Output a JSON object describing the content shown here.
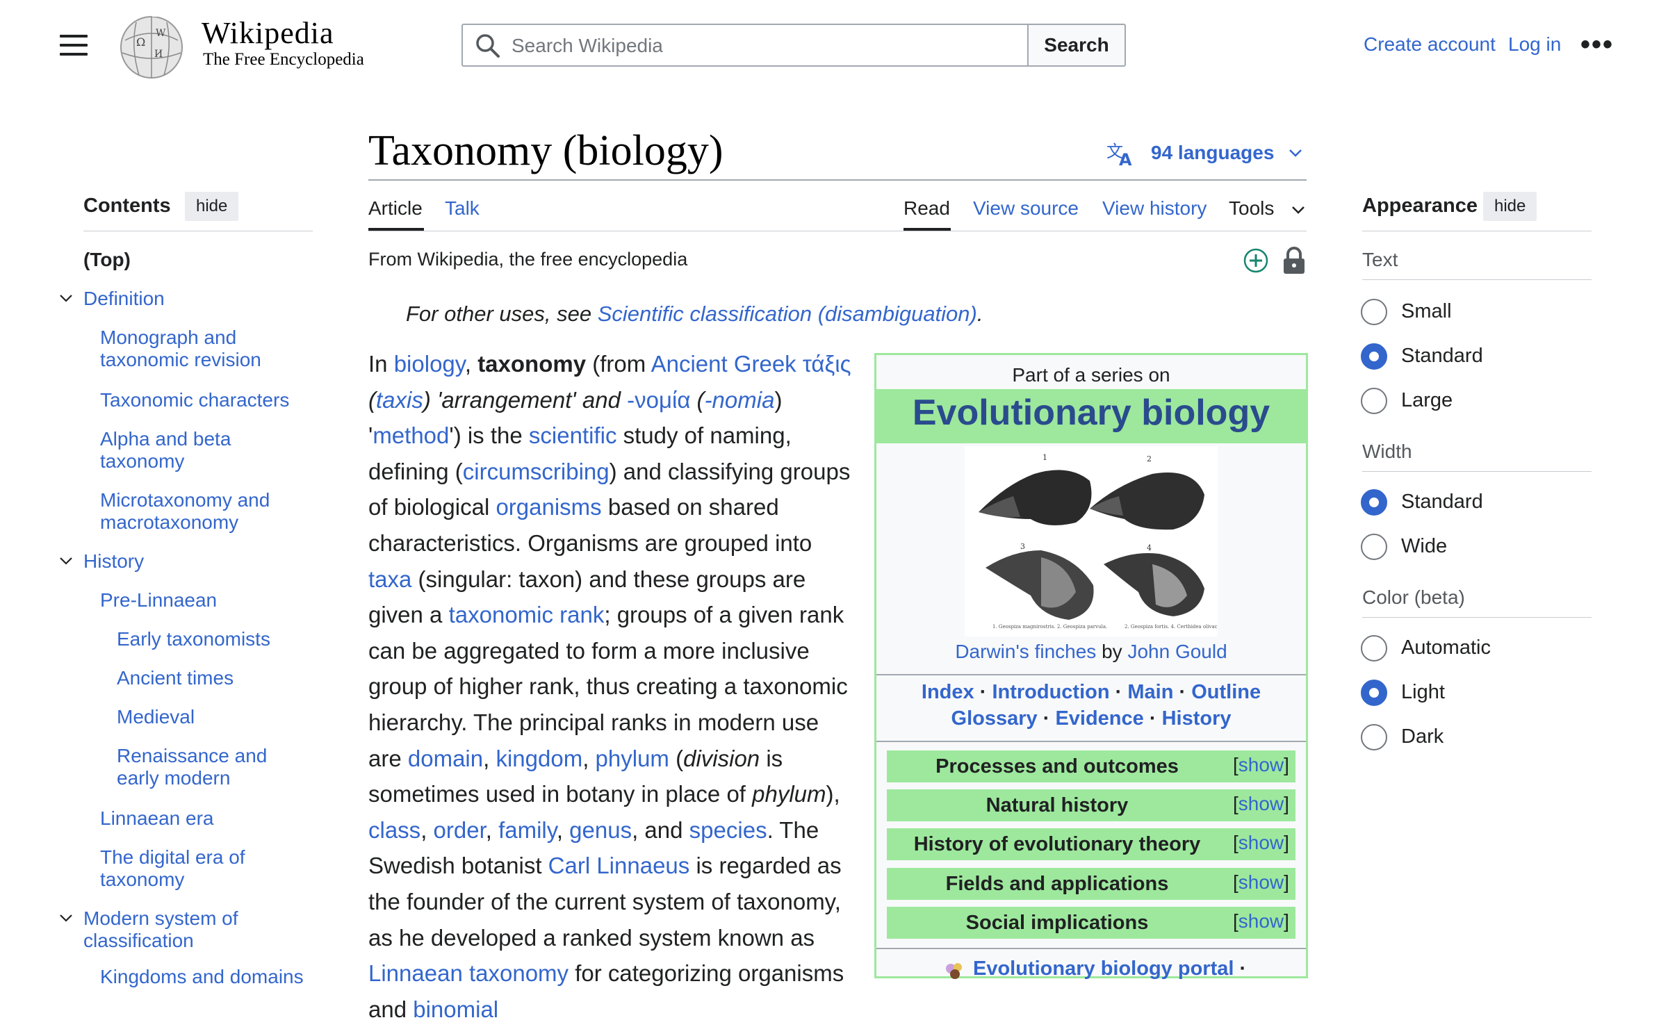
{
  "header": {
    "logo_wordmark": "Wikipedia",
    "logo_tagline": "The Free Encyclopedia",
    "search_placeholder": "Search Wikipedia",
    "search_button": "Search",
    "create_account": "Create account",
    "login": "Log in",
    "more": "•••"
  },
  "page": {
    "title": "Taxonomy (biology)",
    "languages": "94 languages",
    "tabs": {
      "article": "Article",
      "talk": "Talk",
      "read": "Read",
      "view_source": "View source",
      "view_history": "View history",
      "tools": "Tools"
    },
    "from": "From Wikipedia, the free encyclopedia",
    "hatnote_prefix": "For other uses, see ",
    "hatnote_link": "Scientific classification (disambiguation)",
    "hatnote_suffix": "."
  },
  "toc": {
    "title": "Contents",
    "hide": "hide",
    "items": [
      {
        "label": "(Top)"
      },
      {
        "label": "Definition"
      },
      {
        "label": "Monograph and taxonomic revision"
      },
      {
        "label": "Taxonomic characters"
      },
      {
        "label": "Alpha and beta taxonomy"
      },
      {
        "label": "Microtaxonomy and macrotaxonomy"
      },
      {
        "label": "History"
      },
      {
        "label": "Pre-Linnaean"
      },
      {
        "label": "Early taxonomists"
      },
      {
        "label": "Ancient times"
      },
      {
        "label": "Medieval"
      },
      {
        "label": "Renaissance and early modern"
      },
      {
        "label": "Linnaean era"
      },
      {
        "label": "The digital era of taxonomy"
      },
      {
        "label": "Modern system of classification"
      },
      {
        "label": "Kingdoms and domains"
      }
    ]
  },
  "body": {
    "t1": "In ",
    "l1": "biology",
    "t2": ", ",
    "b1": "taxonomy",
    "t3": " (from ",
    "l2": "Ancient Greek",
    "t4": " ",
    "l3": "τάξις",
    "t5": " (",
    "l4": "taxis",
    "t6": ") 'arrangement' and ",
    "l5": "-νομία",
    "t7": " (",
    "l6": "-nomia",
    "t8": ") '",
    "l7": "method",
    "t9": "') is the ",
    "l8": "scientific",
    "t10": " study of naming, defining (",
    "l9": "circumscribing",
    "t11": ") and classifying groups of biological ",
    "l10": "organisms",
    "t12": " based on shared characteristics. Organisms are grouped into ",
    "l11": "taxa",
    "t13": " (singular: taxon) and these groups are given a ",
    "l12": "taxonomic rank",
    "t14": "; groups of a given rank can be aggregated to form a more inclusive group of higher rank, thus creating a taxonomic hierarchy. The principal ranks in modern use are ",
    "l13": "domain",
    "t15": ", ",
    "l14": "kingdom",
    "t16": ", ",
    "l15": "phylum",
    "t17": " (",
    "i1": "division",
    "t18": " is sometimes used in botany in place of ",
    "i2": "phylum",
    "t19": "), ",
    "l16": "class",
    "t20": ", ",
    "l17": "order",
    "t21": ", ",
    "l18": "family",
    "t22": ", ",
    "l19": "genus",
    "t23": ", and ",
    "l20": "species",
    "t24": ". The Swedish botanist ",
    "l21": "Carl Linnaeus",
    "t25": " is regarded as the founder of the current system of taxonomy, as he developed a ranked system known as ",
    "l22": "Linnaean taxonomy",
    "t26": " for categorizing organisms and ",
    "l23": "binomial"
  },
  "infobox": {
    "part_of": "Part of a series on",
    "title": "Evolutionary biology",
    "caption_link1": "Darwin's finches",
    "caption_by": " by ",
    "caption_link2": "John Gould",
    "figure_numbers": [
      "1",
      "2",
      "3",
      "4"
    ],
    "figure_legend_left": "1. Geospiza magnirostris.\n2. Geospiza parvula.",
    "figure_legend_right": "2. Geospiza fortis.\n4. Certhidea olivacea.",
    "nav1": [
      "Index",
      "Introduction",
      "Main",
      "Outline"
    ],
    "nav2": [
      "Glossary",
      "Evidence",
      "History"
    ],
    "sep": " · ",
    "rows": [
      {
        "label": "Processes and outcomes",
        "show": "show"
      },
      {
        "label": "Natural history",
        "show": "show"
      },
      {
        "label": "History of evolutionary theory",
        "show": "show"
      },
      {
        "label": "Fields and applications",
        "show": "show"
      },
      {
        "label": "Social implications",
        "show": "show"
      }
    ],
    "portal": "Evolutionary biology portal",
    "portal_suffix": " ·"
  },
  "appearance": {
    "title": "Appearance",
    "hide": "hide",
    "text_label": "Text",
    "text_options": [
      {
        "label": "Small",
        "selected": false
      },
      {
        "label": "Standard",
        "selected": true
      },
      {
        "label": "Large",
        "selected": false
      }
    ],
    "width_label": "Width",
    "width_options": [
      {
        "label": "Standard",
        "selected": true
      },
      {
        "label": "Wide",
        "selected": false
      }
    ],
    "color_label": "Color (beta)",
    "color_options": [
      {
        "label": "Automatic",
        "selected": false
      },
      {
        "label": "Light",
        "selected": true
      },
      {
        "label": "Dark",
        "selected": false
      }
    ]
  },
  "colors": {
    "link": "#3366cc",
    "infobox_green": "#9de89d",
    "title_blue": "#2a4b8d",
    "plus_green": "#14866d"
  },
  "icons": [
    "menu-icon",
    "wikipedia-globe-icon",
    "search-icon",
    "language-icon",
    "chevron-down-icon",
    "add-watch-icon",
    "lock-icon",
    "portal-icon"
  ]
}
